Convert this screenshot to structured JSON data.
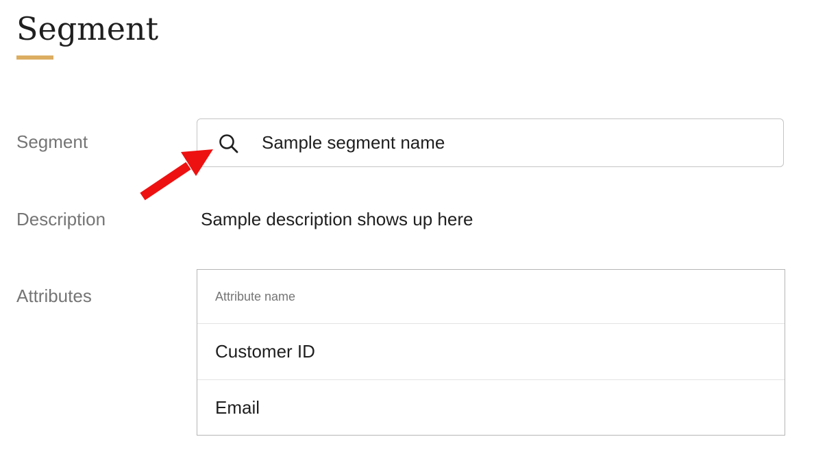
{
  "page": {
    "title": "Segment"
  },
  "fields": {
    "segment_label": "Segment",
    "description_label": "Description",
    "attributes_label": "Attributes"
  },
  "search": {
    "value": "Sample segment name",
    "icon": "search-icon"
  },
  "description": {
    "value": "Sample description shows up here"
  },
  "attributes": {
    "column_header": "Attribute name",
    "rows": [
      "Customer ID",
      "Email"
    ]
  },
  "annotation": {
    "arrow_color": "#ee1111",
    "icon": "arrow-annotation-icon"
  },
  "colors": {
    "accent": "#dcae62",
    "label": "#757575",
    "text": "#1f1f1f",
    "border": "#c4c4c4"
  }
}
